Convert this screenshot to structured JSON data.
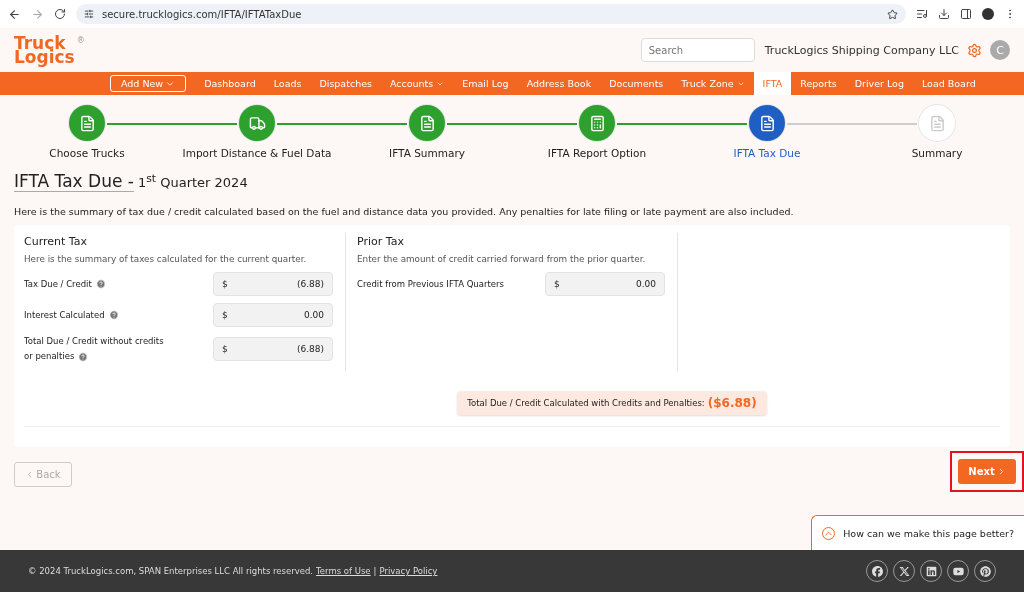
{
  "browser": {
    "url": "secure.trucklogics.com/IFTA/IFTATaxDue"
  },
  "header": {
    "logo_top": "Truck",
    "logo_bottom": "Logics",
    "logo_mark": "®",
    "search_placeholder": "Search",
    "company": "TruckLogics Shipping Company LLC",
    "avatar": "C"
  },
  "nav": [
    {
      "label": "Add New",
      "kind": "button",
      "dropdown": true
    },
    {
      "label": "Dashboard",
      "kind": "link",
      "dropdown": false,
      "selected": false
    },
    {
      "label": "Loads",
      "kind": "link",
      "dropdown": false,
      "selected": false
    },
    {
      "label": "Dispatches",
      "kind": "link",
      "dropdown": false,
      "selected": false
    },
    {
      "label": "Accounts",
      "kind": "link",
      "dropdown": true,
      "selected": false
    },
    {
      "label": "Email Log",
      "kind": "link",
      "dropdown": false,
      "selected": false
    },
    {
      "label": "Address Book",
      "kind": "link",
      "dropdown": false,
      "selected": false
    },
    {
      "label": "Documents",
      "kind": "link",
      "dropdown": false,
      "selected": false
    },
    {
      "label": "Truck Zone",
      "kind": "link",
      "dropdown": true,
      "selected": false
    },
    {
      "label": "IFTA",
      "kind": "link",
      "dropdown": false,
      "selected": true
    },
    {
      "label": "Reports",
      "kind": "link",
      "dropdown": false,
      "selected": false
    },
    {
      "label": "Driver Log",
      "kind": "link",
      "dropdown": false,
      "selected": false
    },
    {
      "label": "Load Board",
      "kind": "link",
      "dropdown": false,
      "selected": false
    }
  ],
  "steps": [
    {
      "label": "Choose Trucks",
      "completed": true,
      "selected": false
    },
    {
      "label": "Import Distance & Fuel Data",
      "completed": true,
      "selected": false
    },
    {
      "label": "IFTA Summary",
      "completed": true,
      "selected": false
    },
    {
      "label": "IFTA Report Option",
      "completed": true,
      "selected": false
    },
    {
      "label": "IFTA Tax Due",
      "completed": false,
      "selected": true
    },
    {
      "label": "Summary",
      "completed": false,
      "selected": false
    }
  ],
  "page": {
    "title": "IFTA Tax Due - ",
    "subtitle": "1$^{st}$ Quarter 2024",
    "description": "Here is the summary of tax due / credit calculated based on the fuel and distance data you provided. Any penalties for late filing or late payment are also included."
  },
  "sections": [
    {
      "title": "Current Tax",
      "description": "Here is the summary of taxes calculated for the current quarter.",
      "fields": [
        {
          "label": "Tax Due / Credit",
          "help": true,
          "currency": "$",
          "value": "(6.88)"
        },
        {
          "label": "Interest Calculated",
          "help": true,
          "currency": "$",
          "value": "0.00"
        },
        {
          "label": "Total Due / Credit without credits or penalties",
          "help": true,
          "currency": "$",
          "value": "(6.88)"
        }
      ]
    },
    {
      "title": "Prior Tax",
      "description": "Enter the amount of credit carried forward from the prior quarter.",
      "fields": [
        {
          "label": "Credit from Previous IFTA Quarters",
          "help": false,
          "currency": "$",
          "value": "0.00"
        }
      ]
    }
  ],
  "total": {
    "label": "Total Due / Credit Calculated with Credits and Penalties:",
    "value": "($6.88)"
  },
  "buttons": {
    "back": "Back",
    "next": "Next",
    "next_highlighted": true
  },
  "feedback": "How can we make this page better?",
  "footer": {
    "copyright": "© 2024 TruckLogics.com, SPAN Enterprises LLC All rights reserved.",
    "links": [
      "Terms of Use",
      "Privacy Policy"
    ],
    "separator": "|"
  }
}
